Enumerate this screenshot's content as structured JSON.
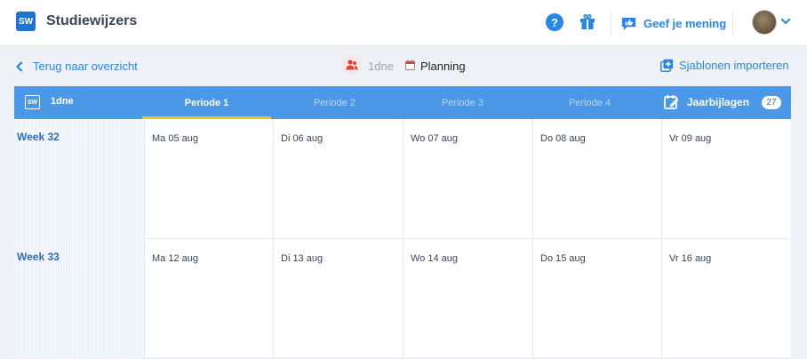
{
  "app": {
    "logo_text": "SW",
    "title": "Studiewijzers"
  },
  "header": {
    "help_symbol": "?",
    "feedback_label": "Geef je mening"
  },
  "subbar": {
    "back_label": "Terug naar overzicht",
    "group_label": "1dne",
    "planning_label": "Planning",
    "import_label": "Sjablonen importeren"
  },
  "tabbar": {
    "logo_text": "SW",
    "group_label": "1dne",
    "periods": [
      "Periode 1",
      "Periode 2",
      "Periode 3",
      "Periode 4"
    ],
    "active_period": "Periode 1",
    "jaarbijlagen_label": "Jaarbijlagen",
    "jaarbijlagen_count": "27"
  },
  "weeks": [
    {
      "label": "Week 32",
      "days": [
        "Ma 05 aug",
        "Di 06 aug",
        "Wo 07 aug",
        "Do 08 aug",
        "Vr 09 aug"
      ]
    },
    {
      "label": "Week 33",
      "days": [
        "Ma 12 aug",
        "Di 13 aug",
        "Wo 14 aug",
        "Do 15 aug",
        "Vr 16 aug"
      ]
    }
  ],
  "colors": {
    "accent": "#2a86e6",
    "tabbar": "#4b97e8",
    "active_tab_underline": "#f4c21f",
    "group_icon": "#e0452f"
  }
}
